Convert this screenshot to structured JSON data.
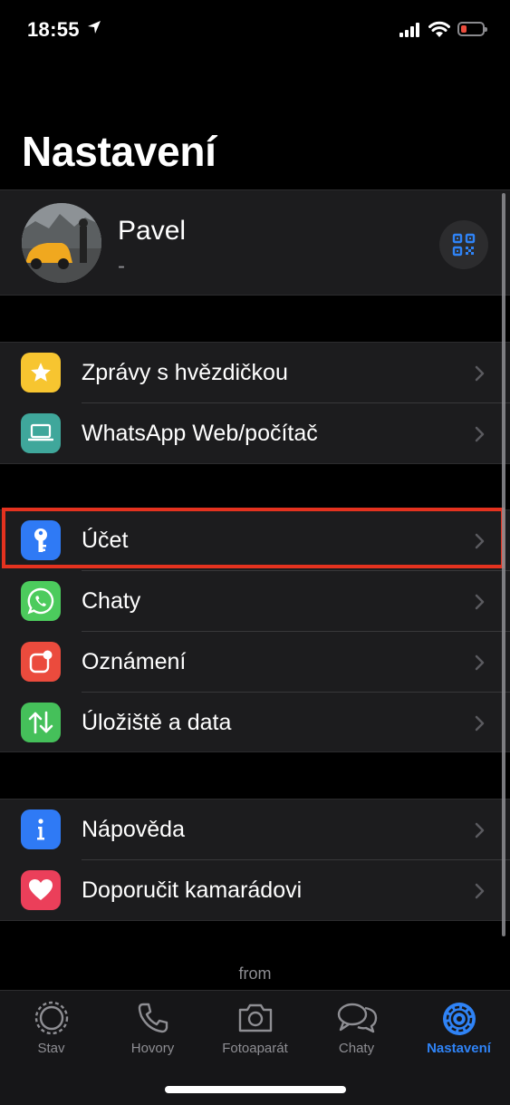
{
  "status_bar": {
    "time": "18:55"
  },
  "page_title": "Nastavení",
  "profile": {
    "name": "Pavel",
    "status": "-"
  },
  "sections": [
    {
      "items": [
        {
          "label": "Zprávy s hvězdičkou",
          "icon": "star-icon",
          "color": "#f7c530"
        },
        {
          "label": "WhatsApp Web/počítač",
          "icon": "laptop-icon",
          "color": "#3fa79b"
        }
      ]
    },
    {
      "items": [
        {
          "label": "Účet",
          "icon": "key-icon",
          "color": "#2f7af5"
        },
        {
          "label": "Chaty",
          "icon": "whatsapp-icon",
          "color": "#4ccb5d"
        },
        {
          "label": "Oznámení",
          "icon": "notification-icon",
          "color": "#eb4b3d"
        },
        {
          "label": "Úložiště a data",
          "icon": "arrows-updown-icon",
          "color": "#45c05a"
        }
      ]
    },
    {
      "items": [
        {
          "label": "Nápověda",
          "icon": "info-icon",
          "color": "#2f7af5"
        },
        {
          "label": "Doporučit kamarádovi",
          "icon": "heart-icon",
          "color": "#eb3f5a"
        }
      ]
    }
  ],
  "footer": {
    "from": "from"
  },
  "tabs": [
    {
      "label": "Stav"
    },
    {
      "label": "Hovory"
    },
    {
      "label": "Fotoaparát"
    },
    {
      "label": "Chaty"
    },
    {
      "label": "Nastavení",
      "active": true
    }
  ],
  "colors": {
    "accent": "#2f83f6",
    "highlight": "#e4321f",
    "row_bg": "#1c1c1e"
  }
}
